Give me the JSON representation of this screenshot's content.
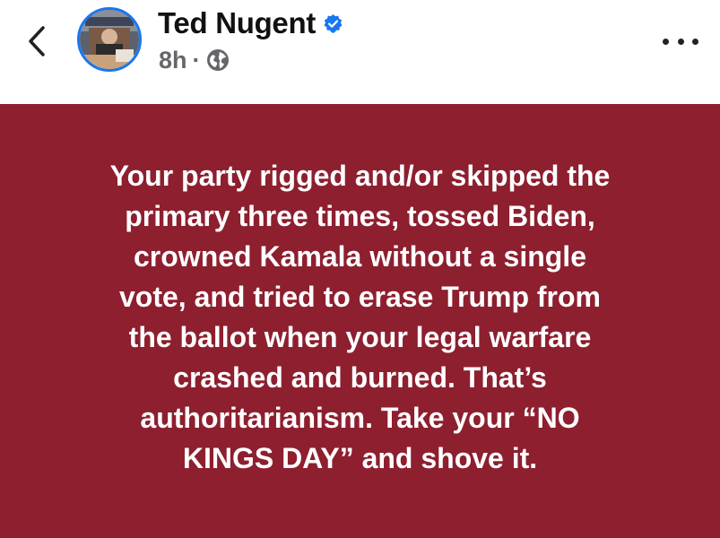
{
  "header": {
    "back_icon": "chevron-left-icon",
    "author": {
      "name": "Ted Nugent",
      "verified_icon": "verified-badge-icon",
      "avatar": "profile-photo"
    },
    "meta": {
      "time": "8h",
      "separator": "·",
      "audience_icon": "globe-icon"
    },
    "more_icon": "more-horizontal-icon"
  },
  "post": {
    "background_color": "#8d1f2f",
    "text_color": "#ffffff",
    "text": "Your party rigged and/or skipped the\nprimary three times, tossed Biden,\ncrowned Kamala without a single\nvote, and tried to erase Trump from\nthe ballot when your legal warfare\ncrashed and burned. That’s\nauthoritarianism. Take your “NO\nKINGS DAY” and shove it."
  },
  "colors": {
    "verified_blue": "#1877f2",
    "meta_gray": "#65676b"
  }
}
